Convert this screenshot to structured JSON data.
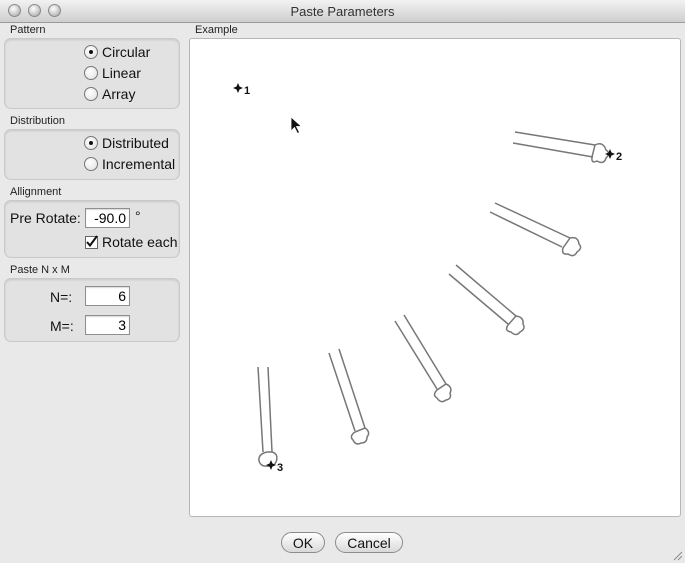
{
  "window": {
    "title": "Paste Parameters"
  },
  "pattern": {
    "label": "Pattern",
    "options": [
      {
        "label": "Circular",
        "selected": true
      },
      {
        "label": "Linear",
        "selected": false
      },
      {
        "label": "Array",
        "selected": false
      }
    ]
  },
  "distribution": {
    "label": "Distribution",
    "options": [
      {
        "label": "Distributed",
        "selected": true
      },
      {
        "label": "Incremental",
        "selected": false
      }
    ]
  },
  "alignment": {
    "label": "Allignment",
    "pre_rotate_label": "Pre Rotate:",
    "pre_rotate_value": "-90.0",
    "degree_symbol": "°",
    "rotate_each_label": "Rotate each",
    "rotate_each_checked": true
  },
  "paste_nxm": {
    "label": "Paste N x M",
    "n_label": "N=:",
    "n_value": "6",
    "m_label": "M=:",
    "m_value": "3"
  },
  "example": {
    "label": "Example",
    "point_labels": [
      "1",
      "2",
      "3"
    ]
  },
  "buttons": {
    "ok": "OK",
    "cancel": "Cancel"
  }
}
